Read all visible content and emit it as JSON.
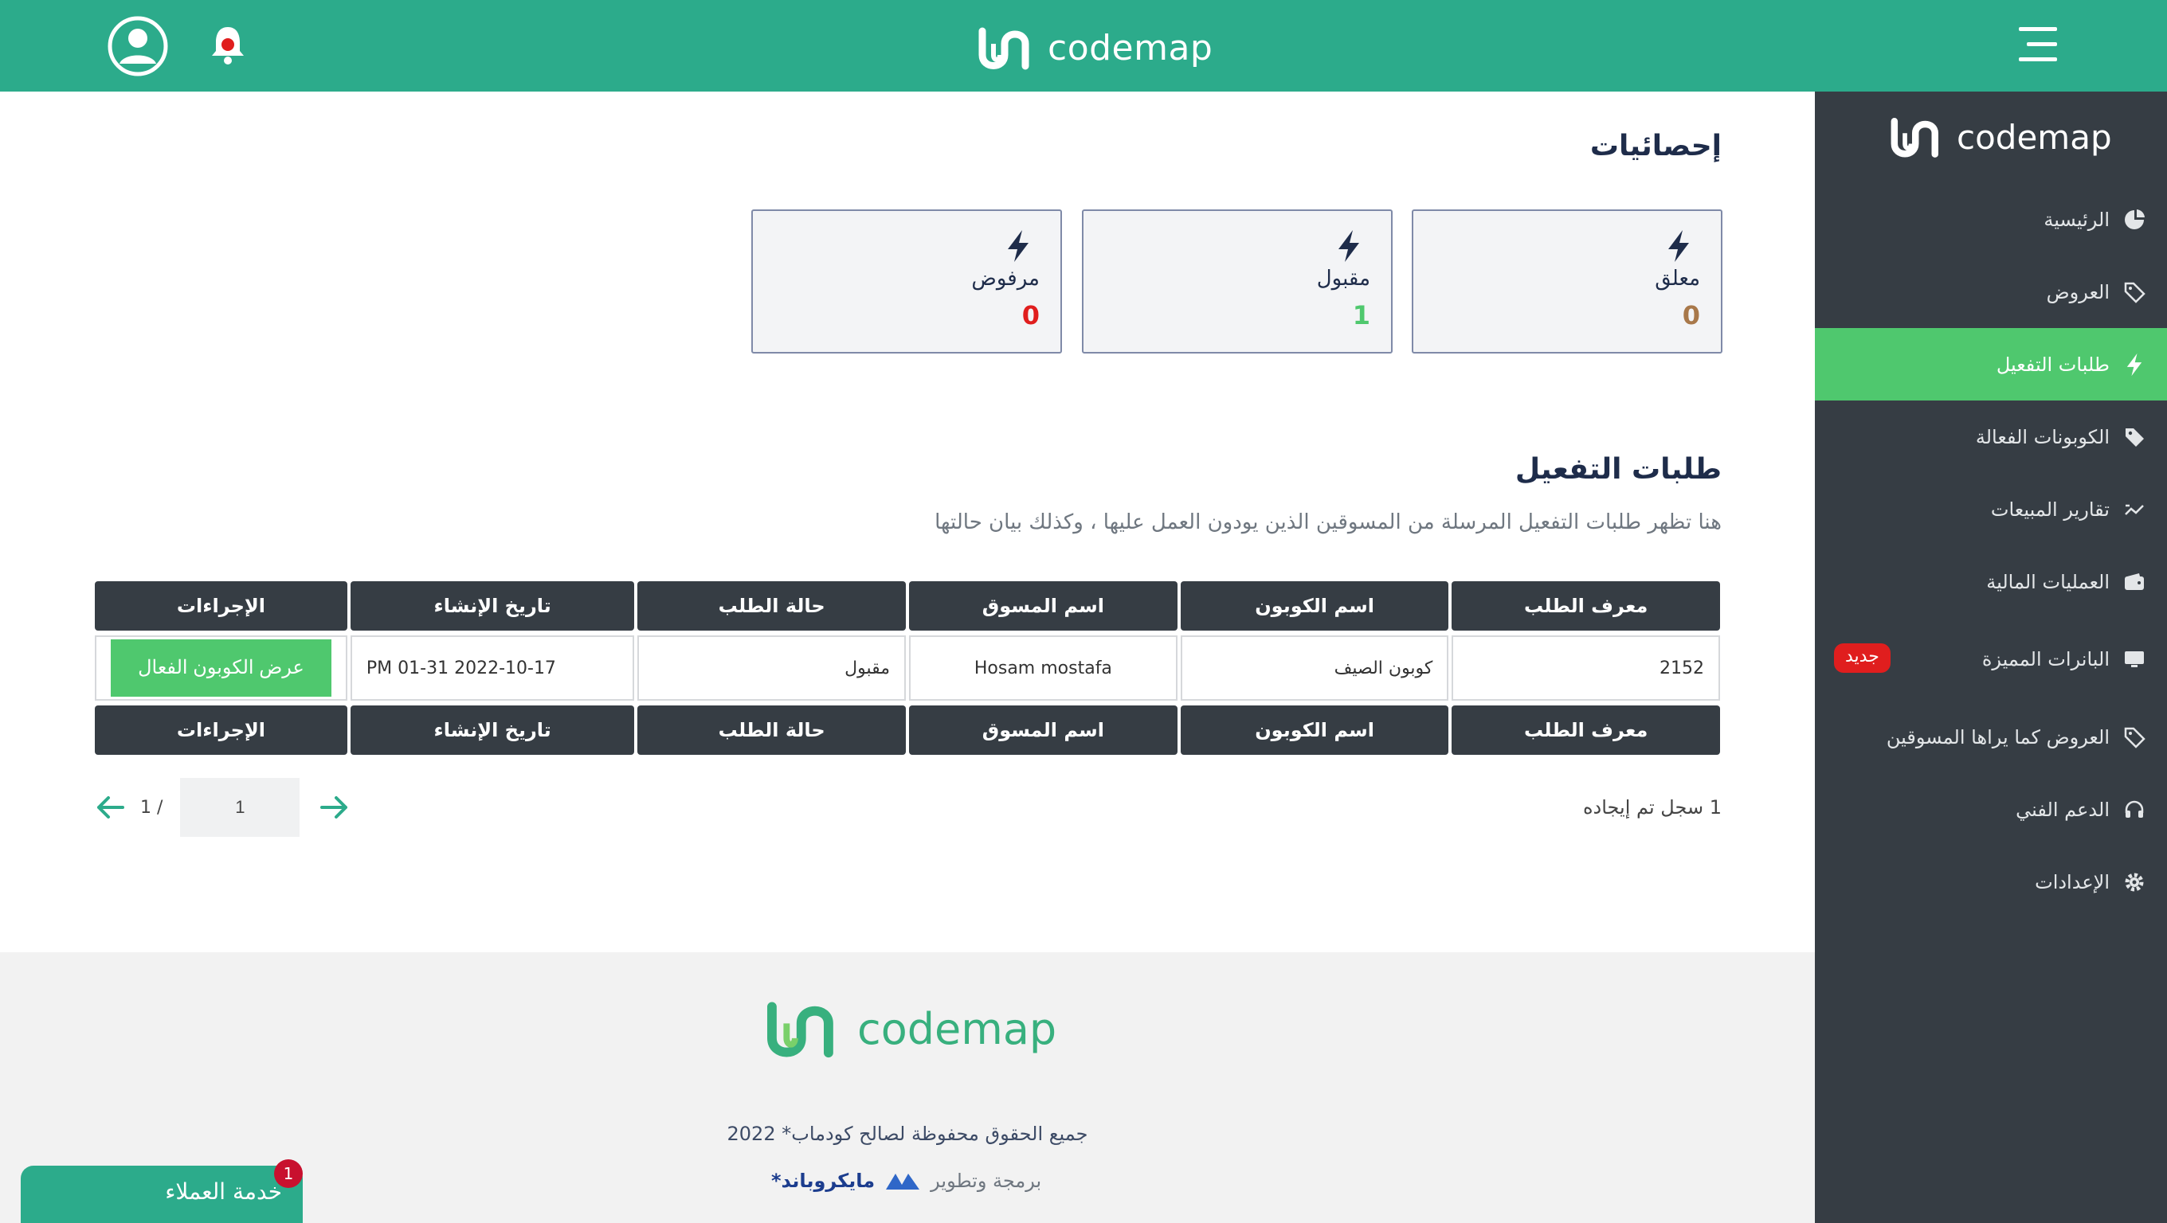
{
  "header": {
    "logo_text": "codemap"
  },
  "sidebar": {
    "logo_text": "codemap",
    "items": [
      {
        "label": "الرئيسية",
        "icon": "pie-chart-icon"
      },
      {
        "label": "العروض",
        "icon": "tag-icon"
      },
      {
        "label": "طلبات التفعيل",
        "icon": "bolt-icon",
        "active": true
      },
      {
        "label": "الكوبونات الفعالة",
        "icon": "tag-icon"
      },
      {
        "label": "تقارير المبيعات",
        "icon": "chart-line-icon"
      },
      {
        "label": "العمليات المالية",
        "icon": "wallet-icon"
      },
      {
        "label": "البانرات المميزة",
        "icon": "monitor-icon",
        "badge": "جديد"
      },
      {
        "label": "العروض كما يراها المسوقين",
        "icon": "tag-icon"
      },
      {
        "label": "الدعم الفني",
        "icon": "headset-icon"
      },
      {
        "label": "الإعدادات",
        "icon": "gear-icon"
      }
    ]
  },
  "stats": {
    "title": "إحصائيات",
    "cards": [
      {
        "label": "معلق",
        "value": "0",
        "color": "#a8784a"
      },
      {
        "label": "مقبول",
        "value": "1",
        "color": "#4fc86e"
      },
      {
        "label": "مرفوض",
        "value": "0",
        "color": "#e01e1e"
      }
    ]
  },
  "requests": {
    "title": "طلبات التفعيل",
    "description": "هنا تظهر طلبات التفعيل المرسلة من المسوقين الذين يودون العمل عليها ، وكذلك بيان حالتها",
    "columns": [
      "معرف الطلب",
      "اسم الكوبون",
      "اسم المسوق",
      "حالة الطلب",
      "تاريخ الإنشاء",
      "الإجراءات"
    ],
    "rows": [
      {
        "id": "2152",
        "coupon": "كوبون الصيف",
        "marketer": "Hosam mostafa",
        "status": "مقبول",
        "created": "2022-10-17 01-31 PM",
        "action": "عرض الكوبون الفعال"
      }
    ],
    "records_text": "1 سجل تم إيجاده",
    "pagination": {
      "current": "1",
      "total": "1 /"
    }
  },
  "footer": {
    "logo_text": "codemap",
    "copyright": "جميع الحقوق محفوظة لصالح كودماب* 2022",
    "credit_label": "برمجة وتطوير",
    "credit_brand": "مايكروباند*"
  },
  "support": {
    "label": "خدمة العملاء",
    "count": "1"
  },
  "colors": {
    "primary": "#2cab8b",
    "accent_green": "#4fc86e",
    "sidebar_bg": "#363d44",
    "navy": "#1e2c4a"
  }
}
